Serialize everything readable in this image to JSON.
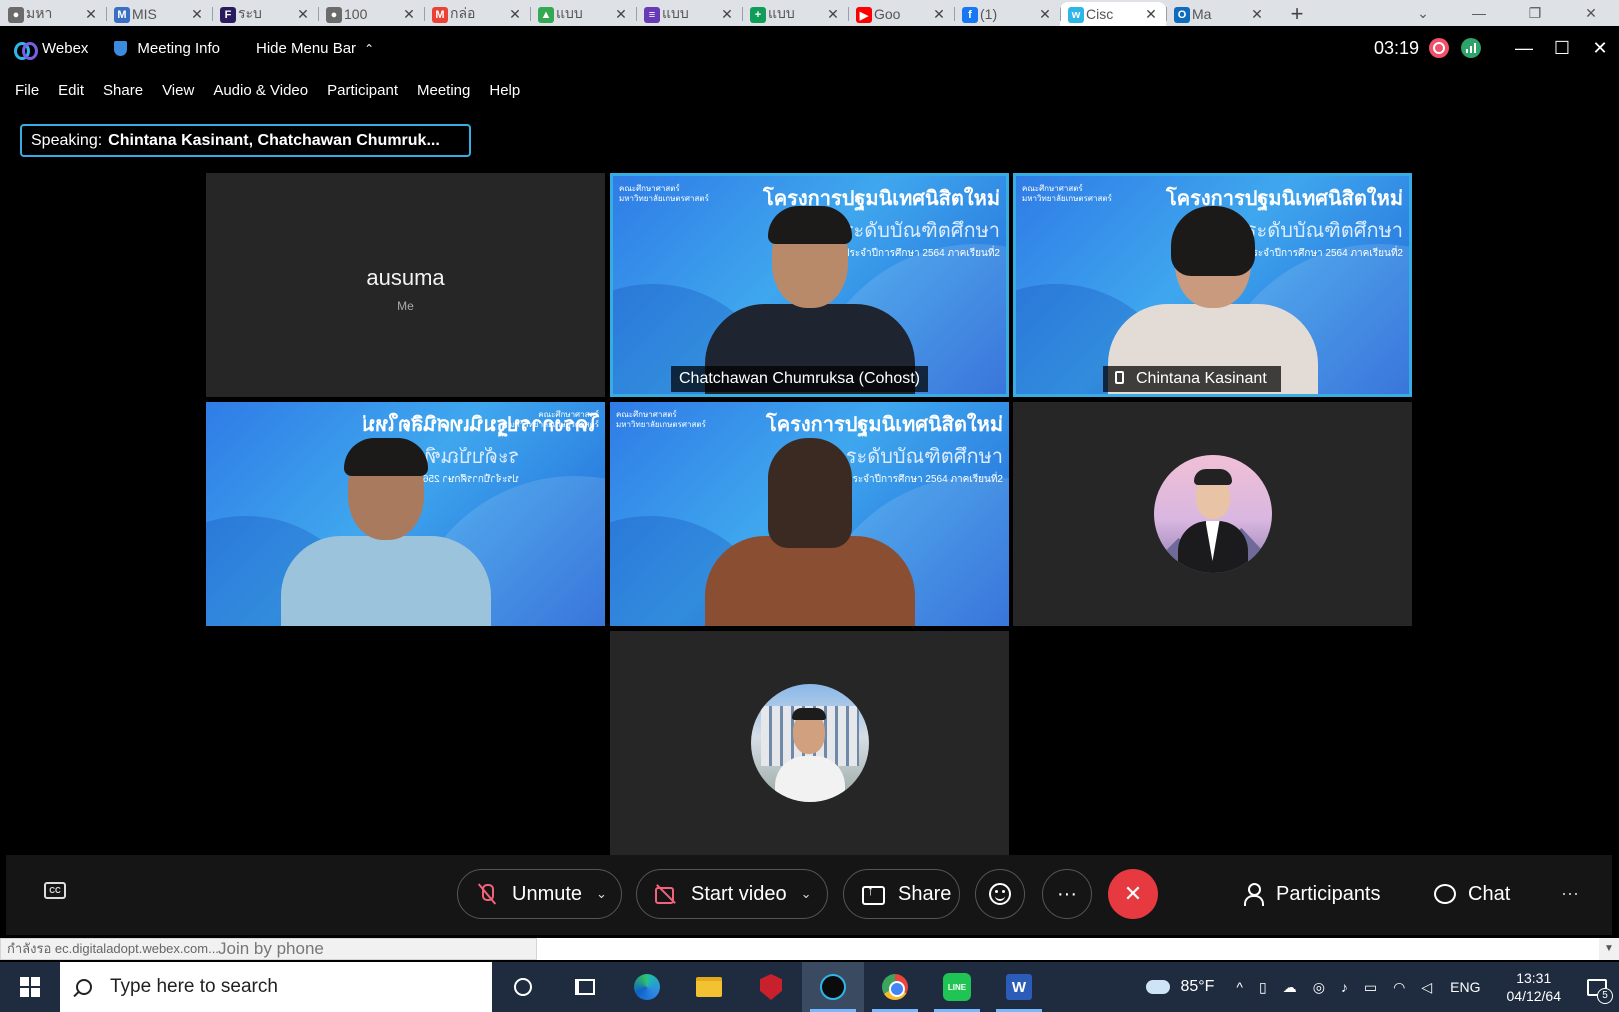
{
  "browser": {
    "tabs": [
      {
        "label": "มหา",
        "fav_color": "#6b6b6b",
        "fav_glyph": "●"
      },
      {
        "label": "MIS",
        "fav_color": "#3a6fc4",
        "fav_glyph": "M"
      },
      {
        "label": "ระบ",
        "fav_color": "#2a1a5e",
        "fav_glyph": "F"
      },
      {
        "label": "100",
        "fav_color": "#6b6b6b",
        "fav_glyph": "●"
      },
      {
        "label": "กล่อ",
        "fav_color": "#ea4335",
        "fav_glyph": "M"
      },
      {
        "label": "แบบ",
        "fav_color": "#34a853",
        "fav_glyph": "▲"
      },
      {
        "label": "แบบ",
        "fav_color": "#673ab7",
        "fav_glyph": "≡"
      },
      {
        "label": "แบบ",
        "fav_color": "#0f9d58",
        "fav_glyph": "+"
      },
      {
        "label": "Goo",
        "fav_color": "#ff0000",
        "fav_glyph": "▶"
      },
      {
        "label": "(1)",
        "fav_color": "#1877f2",
        "fav_glyph": "f"
      },
      {
        "label": "Cisc",
        "fav_color": "#2fb6e8",
        "fav_glyph": "w",
        "active": true
      },
      {
        "label": "Ma",
        "fav_color": "#0f6cbd",
        "fav_glyph": "O"
      }
    ],
    "close_glyph": "✕",
    "new_tab_glyph": "+",
    "window_controls": [
      "⌄",
      "—",
      "❐",
      "✕"
    ]
  },
  "titlebar": {
    "app_name": "Webex",
    "meeting_info": "Meeting Info",
    "hide_menu_bar": "Hide Menu Bar",
    "chevron_glyph": "⌄",
    "timer": "03:19",
    "window_controls": [
      "—",
      "☐",
      "✕"
    ]
  },
  "menu": [
    "File",
    "Edit",
    "Share",
    "View",
    "Audio & Video",
    "Participant",
    "Meeting",
    "Help"
  ],
  "speaking": {
    "label": "Speaking:",
    "names": "Chintana Kasinant, Chatchawan  Chumruk..."
  },
  "participants": {
    "self_name": "ausuma",
    "self_sub": "Me",
    "p1_name": "Chatchawan  Chumruksa  (Cohost)",
    "p2_name": "Chintana Kasinant"
  },
  "slide_banner": {
    "line1": "โครงการปฐมนิเทศนิสิตใหม่",
    "line2": "ระดับบัณฑิตศึกษา",
    "line3": "ประจำปีการศึกษา 2564 ภาคเรียนที่2",
    "logo_text": "คณะศึกษาศาสตร์ มหาวิทยาลัยเกษตรศาสตร์"
  },
  "controls": {
    "cc_glyph": "CC",
    "unmute": "Unmute",
    "start_video": "Start video",
    "share": "Share",
    "more_glyph": "···",
    "end_glyph": "✕",
    "caret_glyph": "⌄",
    "participants": "Participants",
    "chat": "Chat",
    "more_right_glyph": "···"
  },
  "status": {
    "loading_text": "กำลังรอ ec.digitaladopt.webex.com...",
    "join_by_phone": "Join by phone",
    "scroll_glyph": "▼"
  },
  "taskbar": {
    "search_placeholder": "Type here to search",
    "line_label": "LINE",
    "word_label": "W",
    "temperature": "85°F",
    "tray_up_glyph": "^",
    "language": "ENG",
    "time": "13:31",
    "date": "04/12/64",
    "notification_count": "5"
  }
}
